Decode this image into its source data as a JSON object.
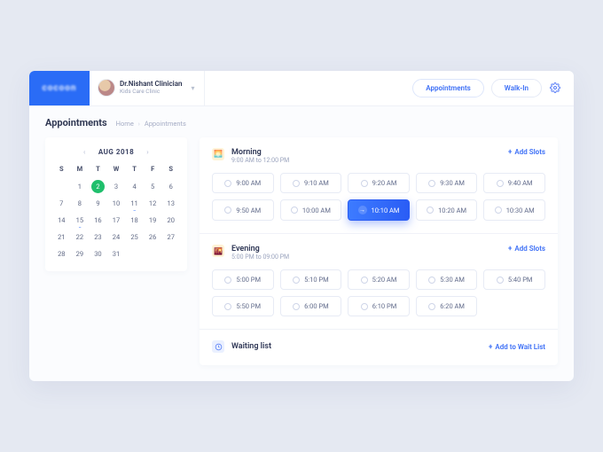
{
  "brand": "cocoon",
  "header": {
    "user_name": "Dr.Nishant Clinician",
    "user_sub": "Kids Care Clinic",
    "nav_appointments": "Appointments",
    "nav_walkin": "Walk-In"
  },
  "subheader": {
    "title": "Appointments",
    "crumb_home": "Home",
    "crumb_current": "Appointments"
  },
  "calendar": {
    "month_label": "AUG 2018",
    "dows": [
      "S",
      "M",
      "T",
      "W",
      "T",
      "F",
      "S"
    ],
    "rows": [
      [
        "",
        "",
        "",
        "1",
        "2",
        "3",
        "4"
      ],
      [
        "5",
        "6",
        "7",
        "8",
        "9",
        "10",
        "11"
      ],
      [
        "12",
        "13",
        "14",
        "15",
        "16",
        "17",
        "18"
      ],
      [
        "19",
        "20",
        "21",
        "22",
        "23",
        "24",
        "25"
      ],
      [
        "26",
        "27",
        "28",
        "29",
        "30",
        "31",
        ""
      ]
    ],
    "selected": "2",
    "dotted": [
      "11",
      "15"
    ],
    "visible_rows": [
      [
        "",
        "1",
        "2",
        "3",
        "4",
        "5",
        "6"
      ],
      [
        "7",
        "8",
        "9",
        "10",
        "11",
        "12",
        "13"
      ],
      [
        "14",
        "15",
        "16",
        "17",
        "18",
        "19",
        "20"
      ],
      [
        "21",
        "22",
        "23",
        "24",
        "25",
        "26",
        "27"
      ],
      [
        "28",
        "29",
        "30",
        "31",
        "",
        "",
        ""
      ]
    ]
  },
  "sections": {
    "morning": {
      "title": "Morning",
      "range": "9:00 AM to 12:00 PM",
      "add_label": "Add Slots",
      "slots": [
        "9:00 AM",
        "9:10 AM",
        "9:20 AM",
        "9:30 AM",
        "9:40 AM",
        "9:50 AM",
        "10:00 AM",
        "10:10 AM",
        "10:20 AM",
        "10:30 AM"
      ],
      "active": "10:10 AM"
    },
    "evening": {
      "title": "Evening",
      "range": "5:00 PM to 09:00 PM",
      "add_label": "Add Slots",
      "slots": [
        "5:00 PM",
        "5:10 PM",
        "5:20 AM",
        "5:30 AM",
        "5:40 PM",
        "5:50 PM",
        "6:00 PM",
        "6:10 PM",
        "6:20 AM"
      ]
    },
    "waiting": {
      "title": "Waiting list",
      "action": "Add to Wait List"
    }
  }
}
